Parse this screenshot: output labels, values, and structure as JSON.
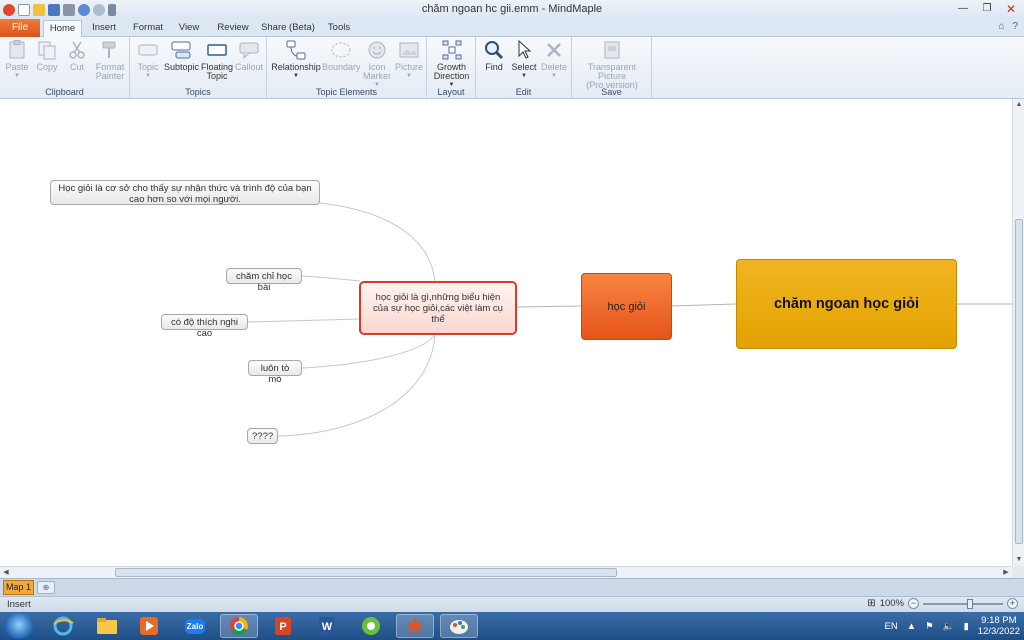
{
  "window": {
    "title": "chăm ngoan hc gii.emm - MindMaple",
    "controls": [
      "—",
      "❐",
      "✕"
    ]
  },
  "tabs": {
    "file": "File",
    "items": [
      "Home",
      "Insert",
      "Format",
      "View",
      "Review",
      "Share (Beta)",
      "Tools"
    ]
  },
  "ribbon": {
    "clipboard": {
      "label": "Clipboard",
      "paste": "Paste",
      "copy": "Copy",
      "cut": "Cut",
      "format_painter": "Format Painter"
    },
    "topics": {
      "label": "Topics",
      "topic": "Topic",
      "subtopic": "Subtopic",
      "floating": "Floating Topic",
      "callout": "Callout"
    },
    "elements": {
      "label": "Topic Elements",
      "relationship": "Relationship",
      "boundary": "Boundary",
      "icon_marker": "Icon Marker",
      "picture": "Picture"
    },
    "layout": {
      "label": "Layout",
      "growth": "Growth Direction"
    },
    "edit": {
      "label": "Edit",
      "find": "Find",
      "select": "Select",
      "delete": "Delete"
    },
    "save": {
      "label": "Save",
      "transparent": "Transparent Picture",
      "pro": "(Pro version)"
    }
  },
  "mindmap": {
    "main": "chăm ngoan học giỏi",
    "branch": "học giỏi",
    "center": "học giỏi là gì,những biểu hiện của sự học giỏi,các việt làm cụ thể",
    "subs": [
      "Học giỏi là cơ sở cho thấy sự nhận thức và trình độ của bạn cao hơn so với mọi người.",
      "chăm chỉ học bài",
      "có độ thích nghi cao",
      "luôn tò mò",
      "????"
    ]
  },
  "sheet": {
    "tab": "Map 1"
  },
  "status": {
    "mode": "Insert",
    "zoom": "100%"
  },
  "taskbar": {
    "lang": "EN",
    "time": "9:18 PM",
    "date": "12/3/2022",
    "zalo": "Zalo"
  }
}
